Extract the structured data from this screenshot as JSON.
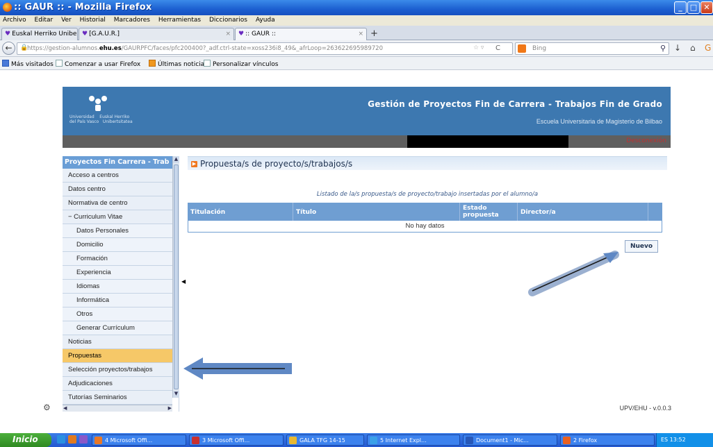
{
  "window": {
    "title": ":: GAUR :: - Mozilla Firefox",
    "buttons": {
      "minimize": "_",
      "maximize": "□",
      "close": "✕"
    }
  },
  "menu": [
    "Archivo",
    "Editar",
    "Ver",
    "Historial",
    "Marcadores",
    "Herramientas",
    "Diccionarios",
    "Ayuda"
  ],
  "tabs": [
    {
      "label": "Euskal Herriko Unibertsitatearen A..."
    },
    {
      "label": "[G.A.U.R.]"
    },
    {
      "label": ":: GAUR ::"
    }
  ],
  "new_tab": "+",
  "nav": {
    "url_prefix": "https://gestion-alumnos.",
    "url_domain": "ehu.es",
    "url_rest": "/GAURPFC/faces/pfc200400?_adf.ctrl-state=xoss236i8_49&_afrLoop=263622695989720",
    "search_placeholder": "Bing"
  },
  "bookmarks": [
    "Más visitados",
    "Comenzar a usar Firefox",
    "Últimas noticias",
    "Personalizar vínculos"
  ],
  "banner": {
    "logo_text": "Universidad    Euskal Herriko\ndel País Vasco   Unibertsitatea",
    "title": "Gestión de Proyectos Fin de Carrera - Trabajos Fin de Grado",
    "subtitle": "Escuela Universitaria de Magisterio de Bilbao",
    "disconnect": "Desconexión"
  },
  "sidebar": {
    "header": "Proyectos Fin Carrera - Trab",
    "items": [
      {
        "label": "Acceso a centros",
        "sub": false,
        "active": false
      },
      {
        "label": "Datos centro",
        "sub": false,
        "active": false
      },
      {
        "label": "Normativa de centro",
        "sub": false,
        "active": false
      },
      {
        "label": "− Curriculum Vitae",
        "sub": false,
        "active": false
      },
      {
        "label": "Datos Personales",
        "sub": true,
        "active": false
      },
      {
        "label": "Domicilio",
        "sub": true,
        "active": false
      },
      {
        "label": "Formación",
        "sub": true,
        "active": false
      },
      {
        "label": "Experiencia",
        "sub": true,
        "active": false
      },
      {
        "label": "Idiomas",
        "sub": true,
        "active": false
      },
      {
        "label": "Informática",
        "sub": true,
        "active": false
      },
      {
        "label": "Otros",
        "sub": true,
        "active": false
      },
      {
        "label": "Generar Currículum",
        "sub": true,
        "active": false
      },
      {
        "label": "Noticias",
        "sub": false,
        "active": false
      },
      {
        "label": "Propuestas",
        "sub": false,
        "active": true
      },
      {
        "label": "Selección proyectos/trabajos",
        "sub": false,
        "active": false
      },
      {
        "label": "Adjudicaciones",
        "sub": false,
        "active": false
      },
      {
        "label": "Tutorías Seminarios",
        "sub": false,
        "active": false
      }
    ]
  },
  "content": {
    "heading": "Propuesta/s de proyecto/s/trabajos/s",
    "caption": "Listado de la/s propuesta/s de proyecto/trabajo insertadas por el alumno/a",
    "columns": [
      "Titulación",
      "Título",
      "Estado propuesta",
      "Director/a"
    ],
    "empty_text": "No hay datos",
    "new_button": "Nuevo"
  },
  "status": {
    "version": "UPV/EHU - v.0.0.3"
  },
  "taskbar": {
    "start": "Inicio",
    "tasks": [
      {
        "label": "4 Microsoft Offi...",
        "color": "#e87828"
      },
      {
        "label": "3 Microsoft Offi...",
        "color": "#c83030"
      },
      {
        "label": "GALA TFG 14-15",
        "color": "#e8b830"
      },
      {
        "label": "5 Internet Expl...",
        "color": "#3aa0e8"
      },
      {
        "label": "Document1 - Mic...",
        "color": "#2858b8"
      },
      {
        "label": "2 Firefox",
        "color": "#e86020"
      }
    ],
    "tray": "ES  13:52"
  }
}
